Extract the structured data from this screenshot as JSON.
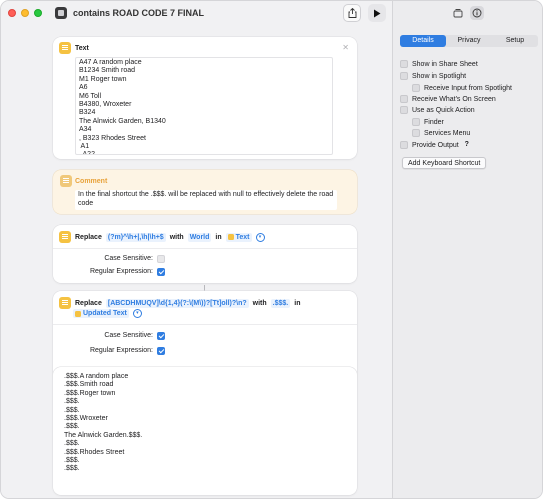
{
  "window": {
    "title": "contains ROAD CODE 7 FINAL"
  },
  "text_action": {
    "title": "Text",
    "content": "A47 A random place\nB1234 Smith road\nM1 Roger town\nA6\nM6 Toll\nB4380, Wroxeter\nB324\nThe Alnwick Garden, B1340\nA34\n, B323 Rhodes Street\n A1\n, A22"
  },
  "comment": {
    "title": "Comment",
    "text": "In the final shortcut the .$$$. will be replaced with null to effectively delete the road code"
  },
  "replace1": {
    "verb": "Replace",
    "pattern": "(?m)^\\h+|,\\h|\\h+$",
    "with_label": "with",
    "replacement": "World",
    "in_label": "in",
    "variable": "Text",
    "options": [
      {
        "label": "Case Sensitive:",
        "checked": false
      },
      {
        "label": "Regular Expression:",
        "checked": true
      }
    ]
  },
  "replace2": {
    "verb": "Replace",
    "pattern": "[ABCDHMUQV]\\d{1,4}(?:\\(M\\))?[Tt]oll)?\\n?",
    "with_label": "with",
    "replacement": ".$$$.",
    "in_label": "in",
    "variable": "Updated Text",
    "options": [
      {
        "label": "Case Sensitive:",
        "checked": true
      },
      {
        "label": "Regular Expression:",
        "checked": true
      }
    ]
  },
  "result": {
    "content": ".$$$.A random place\n.$$$.Smith road\n.$$$.Roger town\n.$$$.\n.$$$.\n.$$$.Wroxeter\n.$$$.\nThe Alnwick Garden.$$$.\n.$$$.\n.$$$.Rhodes Street\n.$$$.\n.$$$."
  },
  "sidebar": {
    "tabs": [
      {
        "label": "Details",
        "active": true
      },
      {
        "label": "Privacy",
        "active": false
      },
      {
        "label": "Setup",
        "active": false
      }
    ],
    "settings": {
      "share_sheet": "Show in Share Sheet",
      "spotlight": "Show in Spotlight",
      "receive_input_spotlight": "Receive Input from Spotlight",
      "receive_on_screen": "Receive What's On Screen",
      "quick_action": "Use as Quick Action",
      "finder": "Finder",
      "services_menu": "Services Menu",
      "provide_output": "Provide Output",
      "help": "?"
    },
    "add_keyboard_shortcut": "Add Keyboard Shortcut"
  },
  "colors": {
    "accent": "#2f7de1",
    "action_yellow": "#f5c242",
    "comment_bg": "#fdf4e4"
  }
}
